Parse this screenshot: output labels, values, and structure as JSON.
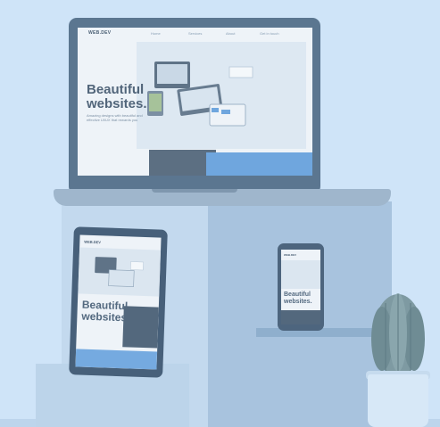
{
  "laptop_site": {
    "logo": "WEB.DEV",
    "nav_links": [
      "Home",
      "Services",
      "About",
      "Get in touch"
    ],
    "headline_line1": "Beautiful",
    "headline_line2": "websites.",
    "subtitle": "Amazing designs with beautiful and effective UI/UX that rewards you"
  },
  "tablet_site": {
    "logo": "WEB.DEV",
    "headline_line1": "Beautiful",
    "headline_line2": "websites."
  },
  "phone_site": {
    "logo": "WEB.DEV",
    "headline_line1": "Beautiful",
    "headline_line2": "websites."
  },
  "colors": {
    "background": "#cfe4f8",
    "accent_blue": "#6fa6de",
    "device_frame": "#5b7690"
  }
}
